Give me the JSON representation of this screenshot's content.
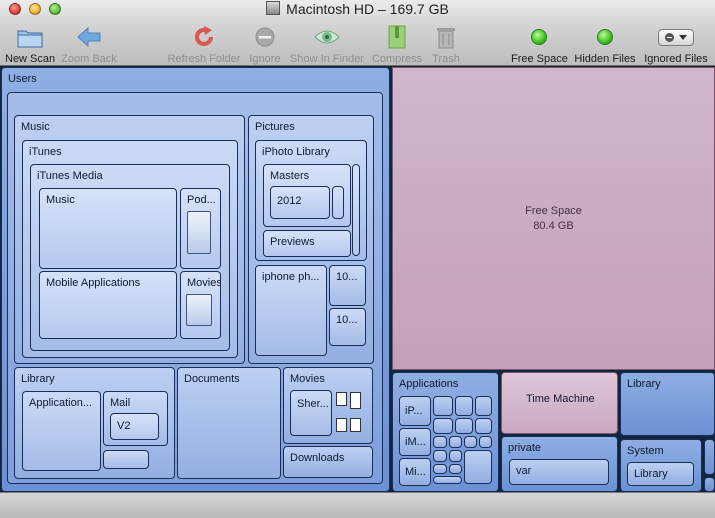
{
  "window": {
    "title": "Macintosh HD – 169.7 GB"
  },
  "toolbar": {
    "new_scan": "New Scan",
    "zoom_back": "Zoom Back",
    "refresh_folder": "Refresh Folder",
    "ignore": "Ignore",
    "show_in_finder": "Show In Finder",
    "compress": "Compress",
    "trash": "Trash",
    "free_space": "Free Space",
    "hidden_files": "Hidden Files",
    "ignored_files": "Ignored Files"
  },
  "icons": [
    "folder-icon",
    "back-arrow-icon",
    "refresh-icon",
    "ignore-icon",
    "eye-icon",
    "compress-icon",
    "trash-icon",
    "green-dot-icon",
    "minus-dropdown-icon"
  ],
  "colors": {
    "folder_blue": "#8eaadd",
    "free_space": "#c4a1ba",
    "toolbar_green": "#3dbd26"
  },
  "treemap": {
    "users": "Users",
    "music": "Music",
    "itunes": "iTunes",
    "itunes_media": "iTunes Media",
    "itunes_music": "Music",
    "podcasts": "Pod...",
    "mobile_apps": "Mobile Applications",
    "movies_itunes": "Movies",
    "pictures": "Pictures",
    "iphoto_library": "iPhoto Library",
    "masters": "Masters",
    "year_2012": "2012",
    "previews": "Previews",
    "iphone_photos": "iphone ph...",
    "ten_a": "10...",
    "ten_b": "10...",
    "library": "Library",
    "application": "Application...",
    "mail": "Mail",
    "v2": "V2",
    "documents": "Documents",
    "movies": "Movies",
    "sher": "Sher...",
    "downloads": "Downloads",
    "free_space_label": "Free Space",
    "free_space_size": "80.4 GB",
    "applications": "Applications",
    "ip": "iP...",
    "im": "iM...",
    "mi": "Mi...",
    "time_machine": "Time Machine",
    "library_root": "Library",
    "private": "private",
    "var": "var",
    "system": "System",
    "system_library": "Library"
  }
}
